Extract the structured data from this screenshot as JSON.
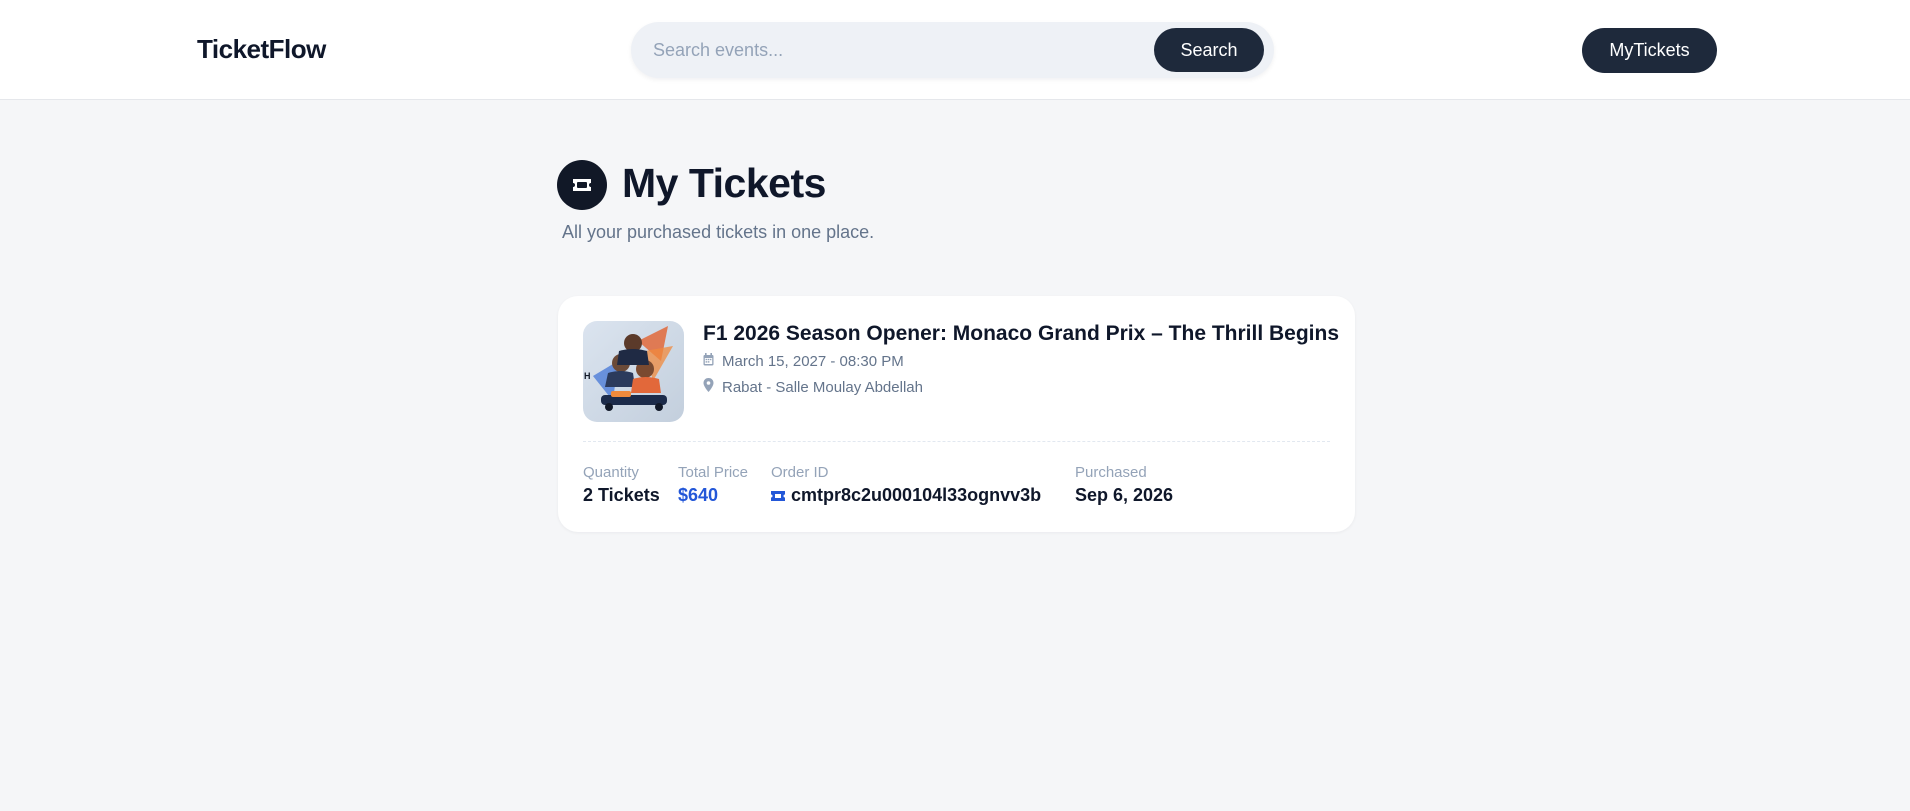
{
  "app": {
    "name": "TicketFlow"
  },
  "search": {
    "placeholder": "Search events...",
    "button_label": "Search"
  },
  "nav": {
    "my_tickets_label": "MyTickets"
  },
  "page": {
    "title": "My Tickets",
    "subtitle": "All your purchased tickets in one place.",
    "icon": "ticket-icon"
  },
  "tickets": [
    {
      "title": "F1 2026 Season Opener: Monaco Grand Prix – The Thrill Begins",
      "date": "March 15, 2027 - 08:30 PM",
      "venue": "Rabat - Salle Moulay Abdellah",
      "quantity_label": "Quantity",
      "quantity": "2 Tickets",
      "price_label": "Total Price",
      "price": "$640",
      "order_label": "Order ID",
      "order_id": "cmtpr8c2u000104l33ognvv3b",
      "purchased_label": "Purchased",
      "purchased": "Sep 6, 2026"
    }
  ],
  "colors": {
    "primary": "#1e293b",
    "accent_price": "#2357d8",
    "background": "#f5f6f8"
  }
}
